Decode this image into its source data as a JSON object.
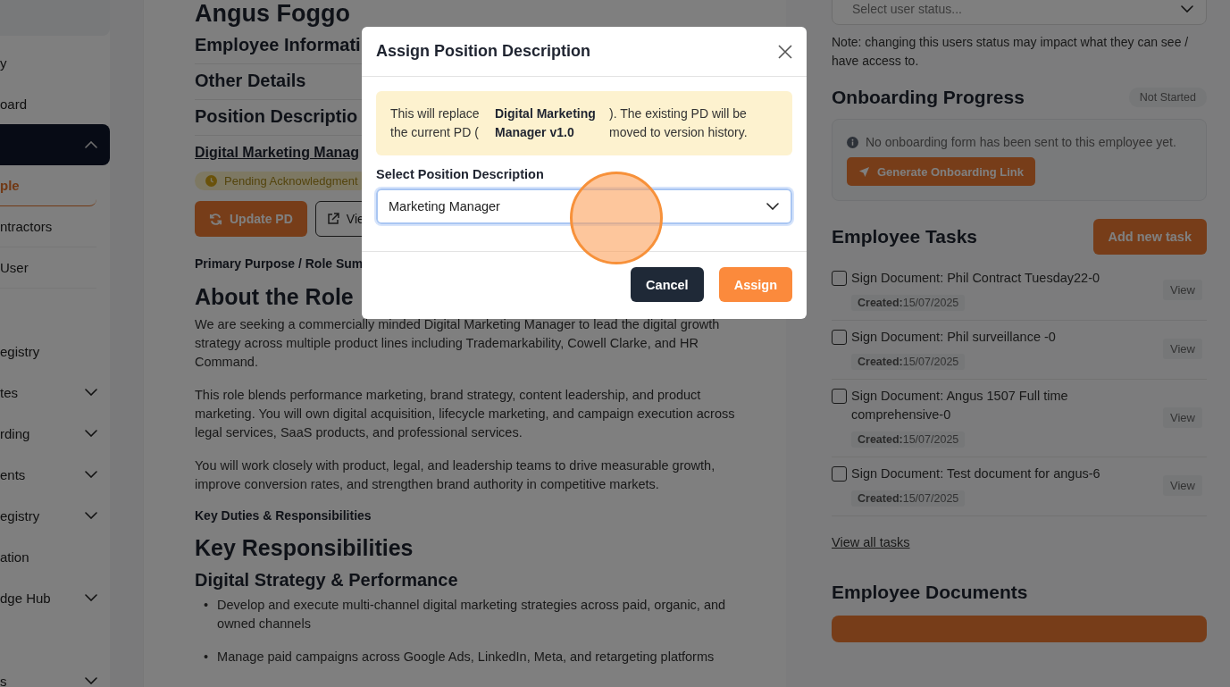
{
  "sidebar": {
    "groups": [
      [
        {
          "kind": "item",
          "label": "y",
          "selected": false
        },
        {
          "kind": "item",
          "label": "oard",
          "selected": false
        },
        {
          "kind": "item",
          "expanded": true,
          "selected": true
        },
        {
          "kind": "subitem",
          "label": "ple",
          "selected": true
        },
        {
          "kind": "subitem",
          "label": "ntractors",
          "selected": false
        },
        {
          "kind": "subitem",
          "label": "User",
          "selected": false
        }
      ],
      [
        {
          "kind": "item",
          "label": "egistry",
          "selected": false
        },
        {
          "kind": "item",
          "label": "tes",
          "expanded": false,
          "selected": false
        },
        {
          "kind": "item",
          "label": "rding",
          "expanded": false,
          "selected": false
        },
        {
          "kind": "item",
          "label": "ents",
          "expanded": false,
          "selected": false
        },
        {
          "kind": "item",
          "label": "egistry",
          "expanded": false,
          "selected": false
        },
        {
          "kind": "item",
          "label": "ation",
          "selected": false
        },
        {
          "kind": "item",
          "label": "dge Hub",
          "expanded": false,
          "selected": false
        }
      ],
      [
        {
          "kind": "item",
          "label": "s",
          "expanded": false,
          "selected": false
        }
      ]
    ]
  },
  "main": {
    "name": "Angus Foggo",
    "sections": [
      "Employee Informati",
      "Other Details",
      "Position Descriptio"
    ],
    "pd_link": "Digital Marketing Manag",
    "status_pill": "Pending Acknowledgment",
    "update_button": "Update PD",
    "view_button": "Vie",
    "summary_label": "Primary Purpose / Role Sum",
    "content": [
      {
        "kind": "h1",
        "text": "About the Role"
      },
      {
        "kind": "p",
        "text": "We are seeking a commercially minded Digital Marketing Manager to lead the digital growth strategy across multiple product lines including Trademarkability, Cowell Clarke, and HR Command."
      },
      {
        "kind": "p",
        "text": "This role blends performance marketing, brand strategy, content leadership, and product marketing. You will own digital acquisition, lifecycle marketing, and campaign execution across legal services, SaaS products, and professional services."
      },
      {
        "kind": "p",
        "text": "You will work closely with product, legal, and leadership teams to drive measurable growth, improve conversion rates, and strengthen brand authority in competitive markets."
      },
      {
        "kind": "label",
        "text": "Key Duties & Responsibilities"
      },
      {
        "kind": "h1",
        "text": "Key Responsibilities"
      },
      {
        "kind": "h2",
        "text": "Digital Strategy & Performance"
      },
      {
        "kind": "li",
        "marker": "•",
        "text": "Develop and execute multi-channel digital marketing strategies across paid, organic, and owned channels"
      },
      {
        "kind": "li",
        "marker": "•",
        "text": "Manage paid campaigns across Google Ads, LinkedIn, Meta, and retargeting platforms"
      }
    ]
  },
  "right": {
    "status_select": {
      "placeholder": "Select user status..."
    },
    "note": "Note: changing this users status may impact what they can see / have access to.",
    "onboarding": {
      "title": "Onboarding Progress",
      "badge": "Not Started",
      "message": "No onboarding form has been sent to this employee yet.",
      "button": "Generate Onboarding Link"
    },
    "tasks": {
      "title": "Employee Tasks",
      "add_button": "Add new task",
      "items": [
        {
          "title": "Sign Document: Phil Contract Tuesday22-0",
          "created_label": "Created:",
          "date": "15/07/2025",
          "view": "View",
          "checked": false
        },
        {
          "title": "Sign Document: Phil surveillance -0",
          "created_label": "Created:",
          "date": "15/07/2025",
          "view": "View",
          "checked": false
        },
        {
          "title": "Sign Document: Angus 1507 Full time comprehensive-0",
          "created_label": "Created:",
          "date": "15/07/2025",
          "view": "View",
          "checked": false
        },
        {
          "title": "Sign Document: Test document for angus-6",
          "created_label": "Created:",
          "date": "15/07/2025",
          "view": "View",
          "checked": false
        }
      ],
      "view_all": "View all tasks"
    },
    "documents_title": "Employee Documents"
  },
  "dialog": {
    "title": "Assign Position Description",
    "info": {
      "before": "This will replace the current PD (",
      "bold": "Digital Marketing Manager v1.0",
      "after": "). The existing PD will be moved to version history."
    },
    "select_label": "Select Position Description",
    "select_value": "Marketing Manager",
    "buttons": [
      {
        "kind": "secondary",
        "label": "Cancel"
      },
      {
        "kind": "primary",
        "label": "Assign"
      }
    ]
  }
}
